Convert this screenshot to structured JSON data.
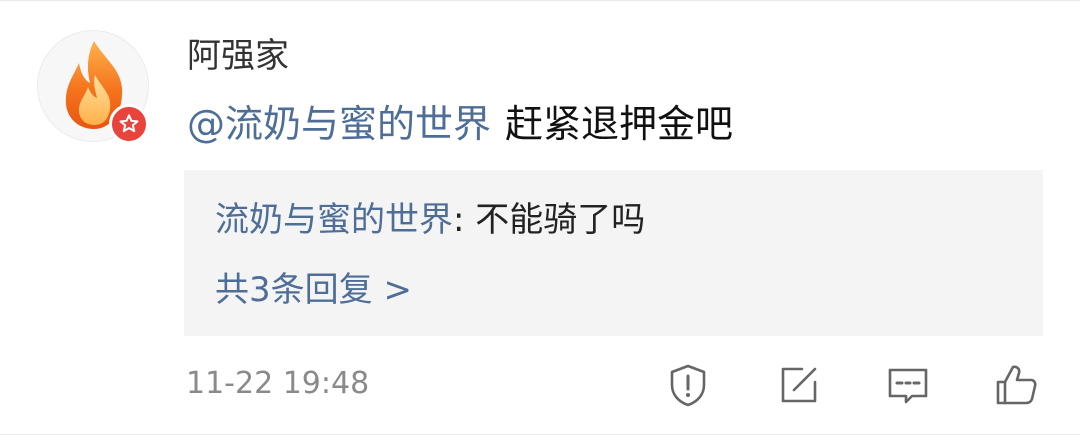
{
  "comment": {
    "username": "阿强家",
    "mention": "@流奶与蜜的世界",
    "text": "赶紧退押金吧",
    "timestamp": "11-22 19:48"
  },
  "reply_preview": {
    "reply_user": "流奶与蜜的世界",
    "separator": ": ",
    "reply_text": "不能骑了吗",
    "more_label": "共3条回复 >"
  },
  "icons": {
    "avatar": "flame-icon",
    "badge": "star-badge-icon",
    "report": "shield-exclamation-icon",
    "repost": "edit-square-icon",
    "comment": "comment-bubble-icon",
    "like": "thumbs-up-icon"
  },
  "colors": {
    "link_blue": "#4e6e97",
    "badge_red": "#e8443b",
    "reply_background": "#f4f4f4"
  }
}
